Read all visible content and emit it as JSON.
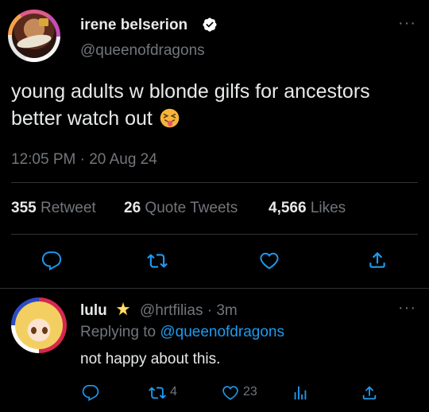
{
  "tweet": {
    "display_name": "irene belserion",
    "handle": "@queenofdragons",
    "text_line1": "young adults w blonde gilfs for ancestors",
    "text_line2": "better watch out",
    "emoji": "squinting-tongue-face",
    "timestamp": "12:05 PM · 20 Aug 24",
    "stats": {
      "retweets_count": "355",
      "retweets_label": "Retweet",
      "quotes_count": "26",
      "quotes_label": "Quote Tweets",
      "likes_count": "4,566",
      "likes_label": "Likes"
    },
    "more_label": "···"
  },
  "reply": {
    "display_name": "lulu",
    "handle_time": "@hrtfilias · 3m",
    "replying_prefix": "Replying to",
    "replying_handle": "@queenofdragons",
    "text": "not happy about this.",
    "retweet_count": "4",
    "like_count": "23",
    "more_label": "···"
  },
  "colors": {
    "background": "#000000",
    "text": "#e7e9ea",
    "muted": "#71767b",
    "accent": "#1d9bf0",
    "divider": "#2f3336"
  },
  "icons": [
    "verified-badge-icon",
    "reply-icon",
    "retweet-icon",
    "like-icon",
    "share-icon",
    "views-icon",
    "star-icon",
    "more-icon"
  ]
}
